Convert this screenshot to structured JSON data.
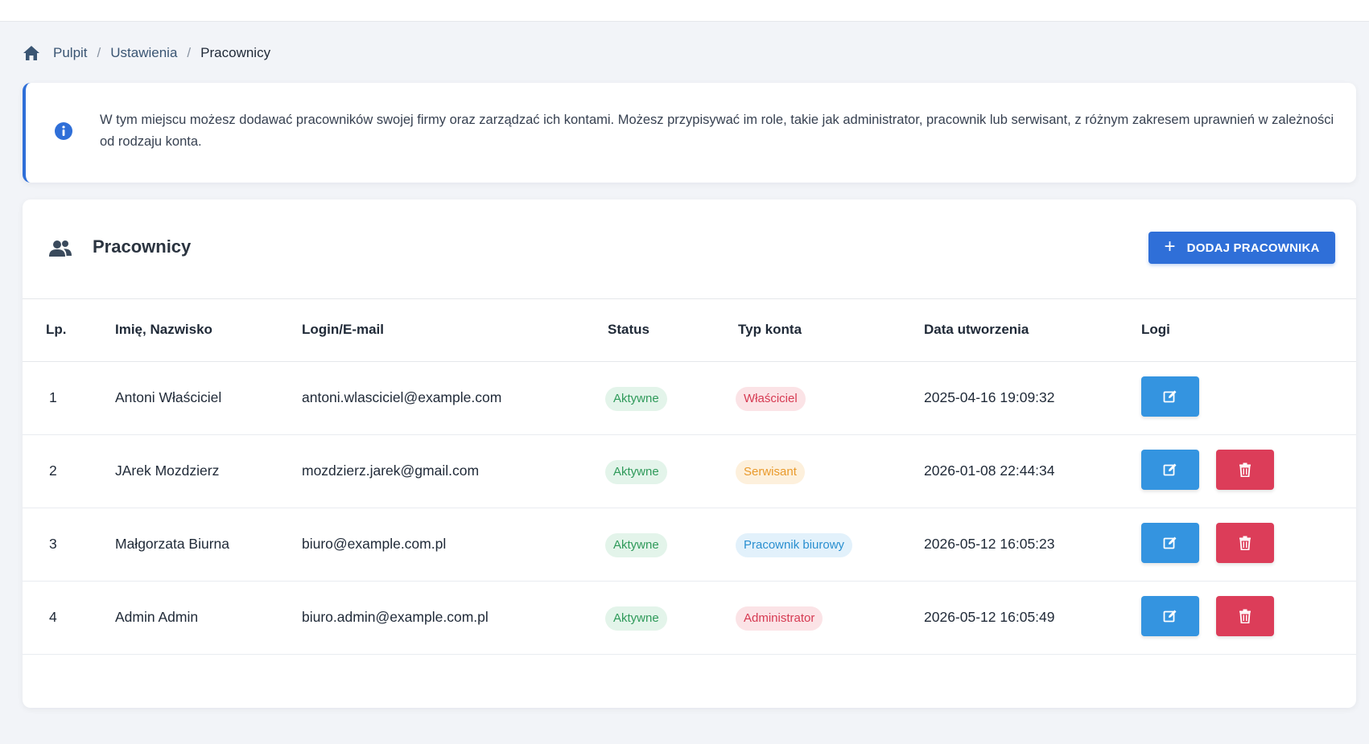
{
  "breadcrumb": {
    "items": [
      "Pulpit",
      "Ustawienia"
    ],
    "current": "Pracownicy",
    "separator": "/"
  },
  "info": {
    "text": "W tym miejscu możesz dodawać pracowników swojej firmy oraz zarządzać ich kontami. Możesz przypisywać im role, takie jak administrator, pracownik lub serwisant, z różnym zakresem uprawnień w zależności od rodzaju konta."
  },
  "card": {
    "title": "Pracownicy",
    "add_button_label": "DODAJ PRACOWNIKA"
  },
  "table": {
    "columns": [
      "Lp.",
      "Imię, Nazwisko",
      "Login/E-mail",
      "Status",
      "Typ konta",
      "Data utworzenia",
      "Logi"
    ],
    "rows": [
      {
        "lp": "1",
        "name": "Antoni Właściciel",
        "email": "antoni.wlasciciel@example.com",
        "status": "Aktywne",
        "type": "Właściciel",
        "type_color": "red",
        "created": "2025-04-16 19:09:32",
        "deletable": false
      },
      {
        "lp": "2",
        "name": "JArek Mozdzierz",
        "email": "mozdzierz.jarek@gmail.com",
        "status": "Aktywne",
        "type": "Serwisant",
        "type_color": "orange",
        "created": "2026-01-08 22:44:34",
        "deletable": true
      },
      {
        "lp": "3",
        "name": "Małgorzata Biurna",
        "email": "biuro@example.com.pl",
        "status": "Aktywne",
        "type": "Pracownik biurowy",
        "type_color": "blue",
        "created": "2026-05-12 16:05:23",
        "deletable": true
      },
      {
        "lp": "4",
        "name": "Admin Admin",
        "email": "biuro.admin@example.com.pl",
        "status": "Aktywne",
        "type": "Administrator",
        "type_color": "red",
        "created": "2026-05-12 16:05:49",
        "deletable": true
      }
    ]
  },
  "icons": {
    "home": "home-icon",
    "info": "info-icon",
    "users": "users-icon",
    "plus": "plus-icon",
    "edit": "edit-icon",
    "delete": "trash-icon"
  },
  "colors": {
    "primary": "#2f6fd8",
    "edit": "#3494e0",
    "delete": "#dc3d59",
    "status_active_bg": "#e3f4ea",
    "status_active_fg": "#2f9a5a"
  }
}
